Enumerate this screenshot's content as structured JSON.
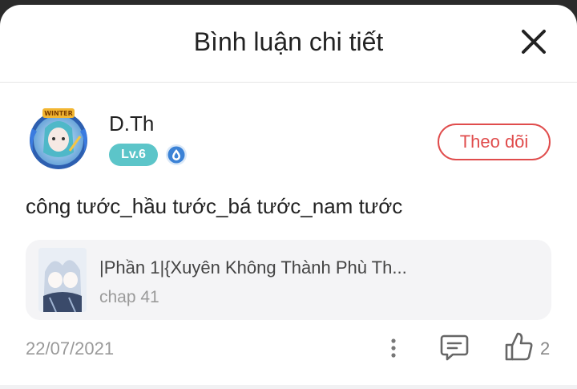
{
  "header": {
    "title": "Bình luận chi tiết",
    "close_icon": "close-icon"
  },
  "comment": {
    "author": {
      "name": "D.Th",
      "level": "Lv.6",
      "avatar_label": "WINTER",
      "rank_icon": "droplet-badge-icon"
    },
    "follow_label": "Theo dõi",
    "text": "công tước_hầu tước_bá tước_nam tước",
    "linked_manga": {
      "title": "|Phần 1|{Xuyên Không Thành Phù Th...",
      "chapter": "chap 41"
    },
    "date": "22/07/2021",
    "likes": "2",
    "icons": {
      "more": "more-vertical-icon",
      "reply": "comment-icon",
      "like": "thumbs-up-icon"
    }
  },
  "colors": {
    "accent_red": "#e04c4c",
    "level_badge": "#5cc5c9",
    "rank_blue": "#3b82d6"
  }
}
